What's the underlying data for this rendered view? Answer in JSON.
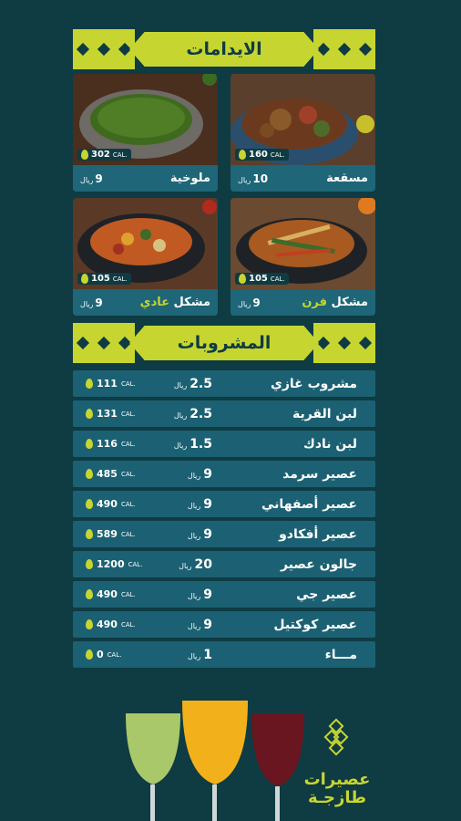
{
  "sections": {
    "mains_title": "الايدامات",
    "drinks_title": "المشروبات"
  },
  "mains": [
    {
      "name": "مسقعة",
      "price": "10",
      "currency": "ريال",
      "cal": "160",
      "cal_unit": "CAL."
    },
    {
      "name": "ملوخية",
      "price": "9",
      "currency": "ريال",
      "cal": "302",
      "cal_unit": "CAL."
    },
    {
      "name": "مشكل",
      "name_hl": "فرن",
      "price": "9",
      "currency": "ريال",
      "cal": "105",
      "cal_unit": "CAL."
    },
    {
      "name": "مشكل",
      "name_hl": "عادي",
      "price": "9",
      "currency": "ريال",
      "cal": "105",
      "cal_unit": "CAL."
    }
  ],
  "drinks": [
    {
      "name": "مشروب غازي",
      "price": "2.5",
      "currency": "ريال",
      "cal": "111",
      "cal_unit": "CAL."
    },
    {
      "name": "لبن القرية",
      "price": "2.5",
      "currency": "ريال",
      "cal": "131",
      "cal_unit": "CAL."
    },
    {
      "name": "لبن نادك",
      "price": "1.5",
      "currency": "ريال",
      "cal": "116",
      "cal_unit": "CAL."
    },
    {
      "name": "عصير سرمد",
      "price": "9",
      "currency": "ريال",
      "cal": "485",
      "cal_unit": "CAL."
    },
    {
      "name": "عصير أصفهاني",
      "price": "9",
      "currency": "ريال",
      "cal": "490",
      "cal_unit": "CAL."
    },
    {
      "name": "عصير أفكادو",
      "price": "9",
      "currency": "ريال",
      "cal": "589",
      "cal_unit": "CAL."
    },
    {
      "name": "جالون عصير",
      "price": "20",
      "currency": "ريال",
      "cal": "1200",
      "cal_unit": "CAL."
    },
    {
      "name": "عصير جي",
      "price": "9",
      "currency": "ريال",
      "cal": "490",
      "cal_unit": "CAL."
    },
    {
      "name": "عصير كوكتيل",
      "price": "9",
      "currency": "ريال",
      "cal": "490",
      "cal_unit": "CAL."
    },
    {
      "name": "مـــاء",
      "price": "1",
      "currency": "ريال",
      "cal": "0",
      "cal_unit": "CAL."
    }
  ],
  "promo": {
    "line1": "عصيرات",
    "line2": "طازجـة"
  },
  "colors": {
    "background": "#0f3b43",
    "accent": "#c7d531",
    "row": "#1b6173"
  },
  "icons": {
    "calorie": "flame-icon",
    "ornament": "diamond-pattern-icon"
  }
}
